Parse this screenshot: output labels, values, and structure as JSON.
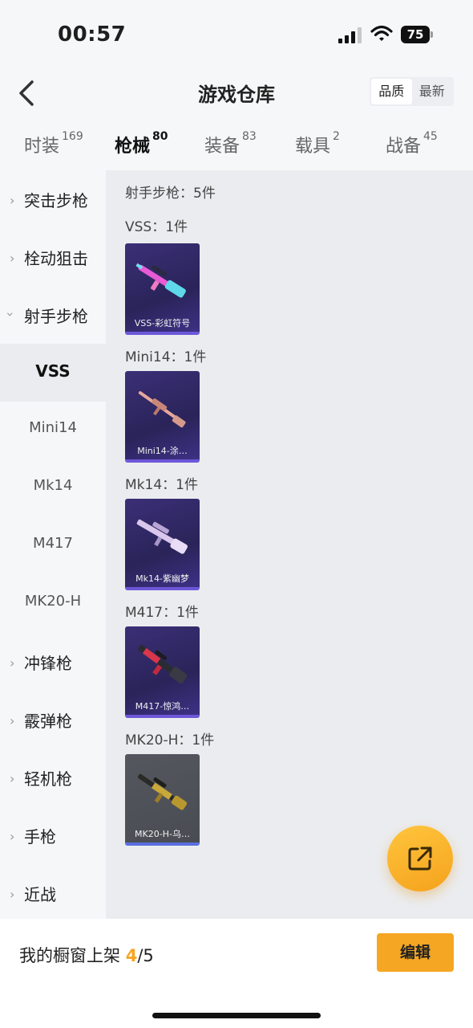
{
  "status_bar": {
    "time": "00:57",
    "battery": "75"
  },
  "header": {
    "title": "游戏仓库",
    "sort_options": [
      "品质",
      "最新"
    ],
    "selected_sort": "品质"
  },
  "tabs": [
    {
      "label": "时装",
      "count": "169"
    },
    {
      "label": "枪械",
      "count": "80"
    },
    {
      "label": "装备",
      "count": "83"
    },
    {
      "label": "载具",
      "count": "2"
    },
    {
      "label": "战备",
      "count": "45"
    }
  ],
  "active_tab": "枪械",
  "sidebar": {
    "categories": [
      {
        "label": "突击步枪",
        "expanded": false
      },
      {
        "label": "栓动狙击",
        "expanded": false
      },
      {
        "label": "射手步枪",
        "expanded": true
      },
      {
        "label": "冲锋枪",
        "expanded": false
      },
      {
        "label": "霰弹枪",
        "expanded": false
      },
      {
        "label": "轻机枪",
        "expanded": false
      },
      {
        "label": "手枪",
        "expanded": false
      },
      {
        "label": "近战",
        "expanded": false
      }
    ],
    "subitems": [
      "VSS",
      "Mini14",
      "Mk14",
      "M417",
      "MK20-H"
    ],
    "selected_subitem": "VSS"
  },
  "content": {
    "summary": "射手步枪：5件",
    "groups": [
      {
        "header": "VSS：1件",
        "item_name": "VSS-彩虹符号",
        "style": "purple"
      },
      {
        "header": "Mini14：1件",
        "item_name": "Mini14-涂…",
        "style": "purple"
      },
      {
        "header": "Mk14：1件",
        "item_name": "Mk14-紫幽梦",
        "style": "purple"
      },
      {
        "header": "M417：1件",
        "item_name": "M417-惊鸿…",
        "style": "purple"
      },
      {
        "header": "MK20-H：1件",
        "item_name": "MK20-H-乌…",
        "style": "grey"
      }
    ]
  },
  "bottom_bar": {
    "shelf_label": "我的橱窗上架",
    "shelf_count": "4",
    "shelf_total": "/5",
    "edit_label": "编辑"
  },
  "colors": {
    "accent": "#f5a623",
    "purple_card": "#2f2866",
    "grey_card": "#505259"
  },
  "icons": [
    "back-arrow-icon",
    "signal-icon",
    "wifi-icon",
    "battery-icon",
    "chevron-right-icon",
    "chevron-down-icon",
    "share-external-icon"
  ]
}
